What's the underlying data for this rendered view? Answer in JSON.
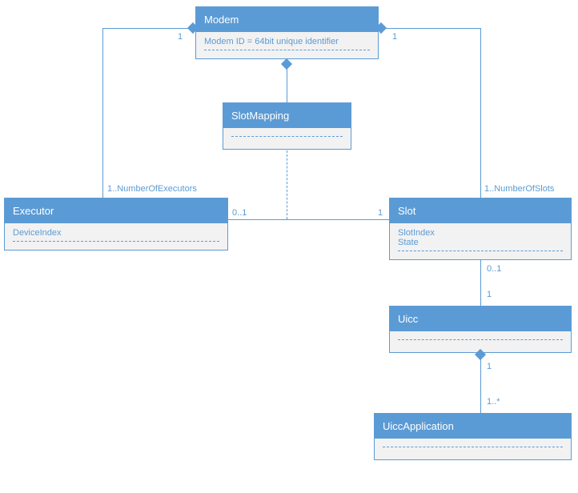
{
  "modem": {
    "title": "Modem",
    "attr": "Modem ID = 64bit unique identifier"
  },
  "slotmapping": {
    "title": "SlotMapping"
  },
  "executor": {
    "title": "Executor",
    "attr": "DeviceIndex"
  },
  "slot": {
    "title": "Slot",
    "attr1": "SlotIndex",
    "attr2": "State"
  },
  "uicc": {
    "title": "Uicc"
  },
  "uiccapp": {
    "title": "UiccApplication"
  },
  "mult": {
    "modem_left": "1",
    "modem_right": "1",
    "exec_top": "1..NumberOfExecutors",
    "slot_top": "1..NumberOfSlots",
    "exec_right": "0..1",
    "slot_left": "1",
    "slot_bottom": "0..1",
    "uicc_top": "1",
    "uicc_bottom": "1",
    "uiccapp_top": "1..*"
  }
}
